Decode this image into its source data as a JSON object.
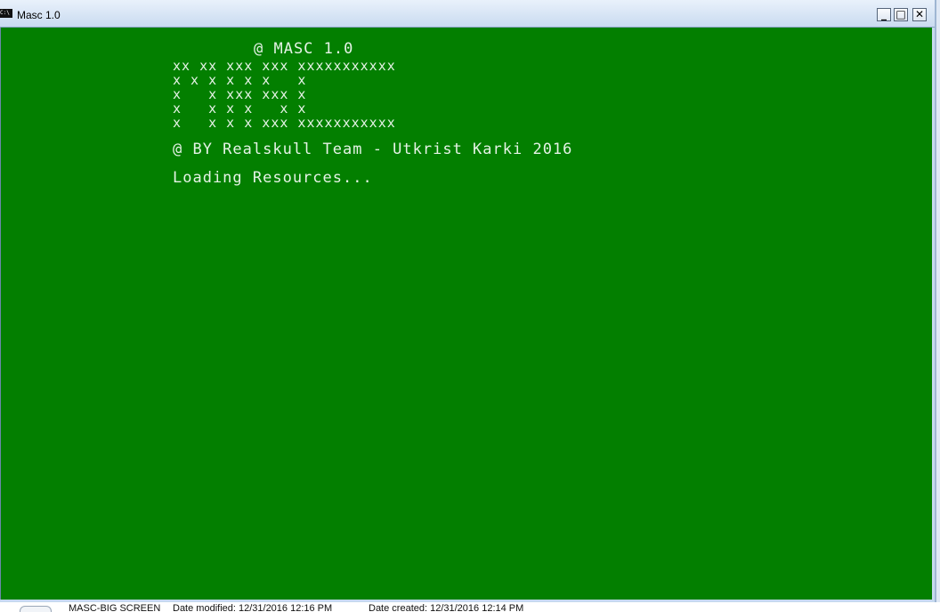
{
  "window": {
    "title": "Masc 1.0",
    "icon": "console-app-icon",
    "controls": {
      "minimize": "_",
      "maximize": "□",
      "close": "✕"
    }
  },
  "console": {
    "header": "@ MASC 1.0",
    "banner_lines": [
      "xx xx xxx xxx xxxxxxxxxxx",
      "x x x x x x   x",
      "x   x xxx xxx x",
      "x   x x x   x x",
      "x   x x x xxx xxxxxxxxxxx"
    ],
    "credit": "@ BY Realskull Team - Utkrist Karki 2016",
    "status": "Loading Resources..."
  },
  "file_strip": {
    "name": "MASC-BIG SCREEN",
    "modified": "Date modified: 12/31/2016 12:16 PM",
    "created": "Date created: 12/31/2016 12:14 PM"
  },
  "colors": {
    "console_background": "#037f00",
    "console_text": "#e6f3e6",
    "titlebar": "#c9dbf0"
  }
}
